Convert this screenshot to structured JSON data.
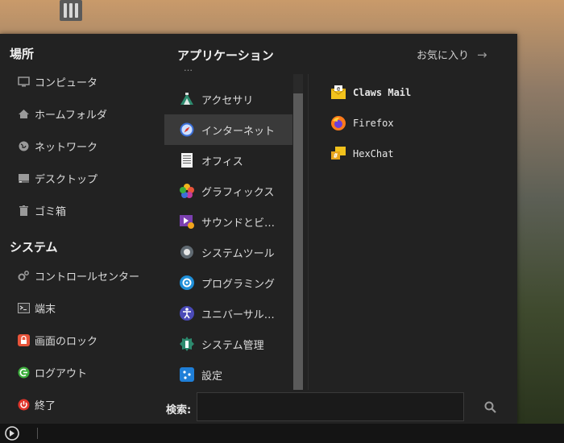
{
  "places": {
    "heading": "場所",
    "items": [
      {
        "label": "コンピュータ",
        "icon": "monitor-icon"
      },
      {
        "label": "ホームフォルダ",
        "icon": "home-icon"
      },
      {
        "label": "ネットワーク",
        "icon": "globe-icon"
      },
      {
        "label": "デスクトップ",
        "icon": "desktop-icon"
      },
      {
        "label": "ゴミ箱",
        "icon": "trash-icon"
      }
    ]
  },
  "system": {
    "heading": "システム",
    "items": [
      {
        "label": "コントロールセンター",
        "icon": "gear-icon"
      },
      {
        "label": "端末",
        "icon": "terminal-icon"
      },
      {
        "label": "画面のロック",
        "icon": "lock-icon"
      },
      {
        "label": "ログアウト",
        "icon": "logout-icon"
      },
      {
        "label": "終了",
        "icon": "power-icon"
      }
    ]
  },
  "categories": {
    "heading": "アプリケーション",
    "partial_top": "…",
    "items": [
      {
        "label": "アクセサリ",
        "icon": "accessories-icon"
      },
      {
        "label": "インターネット",
        "icon": "internet-icon"
      },
      {
        "label": "オフィス",
        "icon": "office-icon"
      },
      {
        "label": "グラフィックス",
        "icon": "graphics-icon"
      },
      {
        "label": "サウンドとビ…",
        "icon": "multimedia-icon"
      },
      {
        "label": "システムツール",
        "icon": "system-tools-icon"
      },
      {
        "label": "プログラミング",
        "icon": "programming-icon"
      },
      {
        "label": "ユニバーサル…",
        "icon": "accessibility-icon"
      },
      {
        "label": "システム管理",
        "icon": "administration-icon"
      },
      {
        "label": "設定",
        "icon": "settings-icon"
      }
    ],
    "selected": "インターネット"
  },
  "favorites": {
    "label": "お気に入り"
  },
  "apps": [
    {
      "label": "Claws Mail",
      "icon": "claws-mail-icon"
    },
    {
      "label": "Firefox",
      "icon": "firefox-icon"
    },
    {
      "label": "HexChat",
      "icon": "hexchat-icon"
    }
  ],
  "search": {
    "label": "検索:",
    "value": ""
  }
}
